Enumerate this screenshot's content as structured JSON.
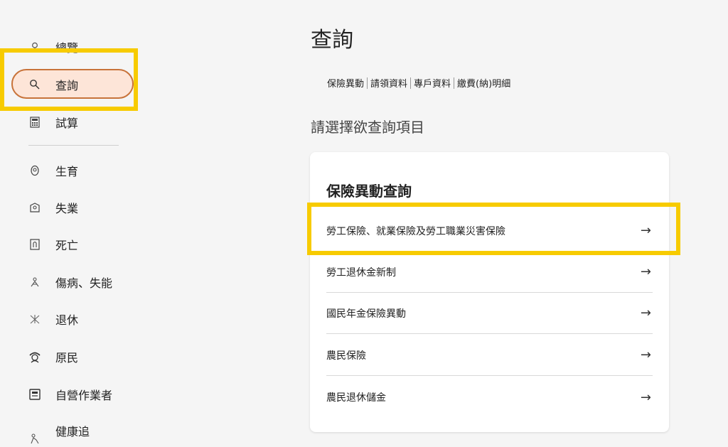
{
  "sidebar": {
    "items": [
      {
        "label": "總覽",
        "icon": "overview-icon"
      },
      {
        "label": "查詢",
        "icon": "search-icon"
      },
      {
        "label": "試算",
        "icon": "calculator-icon"
      },
      {
        "label": "生育",
        "icon": "birth-icon"
      },
      {
        "label": "失業",
        "icon": "unemployment-icon"
      },
      {
        "label": "死亡",
        "icon": "death-icon"
      },
      {
        "label": "傷病、失能",
        "icon": "injury-icon"
      },
      {
        "label": "退休",
        "icon": "retirement-icon"
      },
      {
        "label": "原民",
        "icon": "indigenous-icon"
      },
      {
        "label": "自營作業者",
        "icon": "self-employed-icon"
      },
      {
        "label": "健康追",
        "icon": "health-icon"
      }
    ]
  },
  "main": {
    "title": "查詢",
    "tabs": [
      "保險異動",
      "請領資料",
      "專戶資料",
      "繳費(納)明細"
    ],
    "subtitle": "請選擇欲查詢項目",
    "card": {
      "title": "保險異動查詢",
      "rows": [
        "勞工保險、就業保險及勞工職業災害保險",
        "勞工退休金新制",
        "國民年金保險異動",
        "農民保險",
        "農民退休儲金"
      ],
      "arrow": "→"
    }
  },
  "colors": {
    "highlight": "#f7cb00",
    "active_bg": "#fde5d8",
    "active_border": "#c8733a"
  }
}
